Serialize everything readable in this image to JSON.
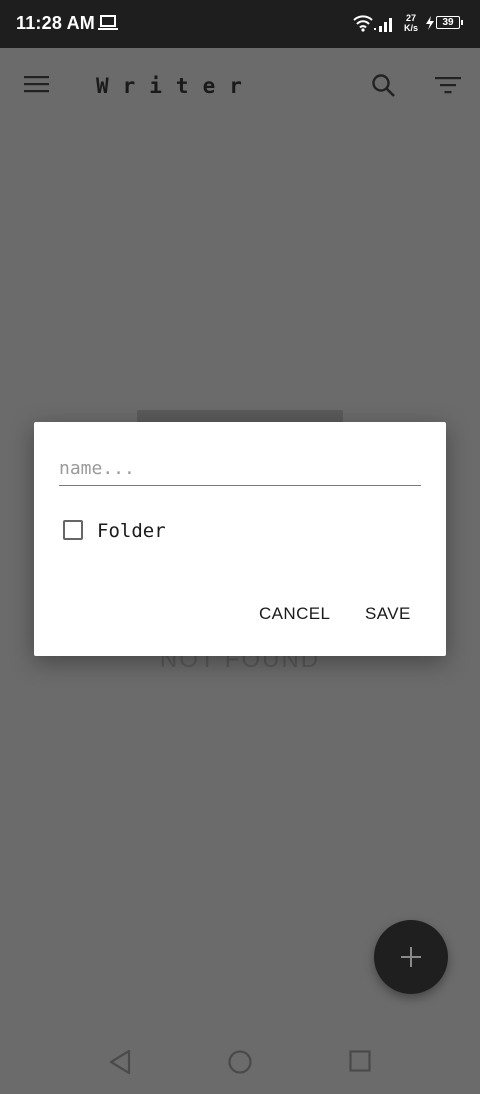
{
  "status_bar": {
    "time": "11:28 AM",
    "net_speed_value": "27",
    "net_speed_unit": "K/s",
    "battery": "39"
  },
  "app_bar": {
    "title": "Writer"
  },
  "empty_state": {
    "text": "NOT FOUND"
  },
  "dialog": {
    "name_placeholder": "name...",
    "name_value": "",
    "folder_label": "Folder",
    "folder_checked": false,
    "cancel_label": "CANCEL",
    "save_label": "SAVE"
  },
  "icons": {
    "menu": "menu-icon",
    "search": "search-icon",
    "filter": "filter-icon",
    "fab": "plus-icon",
    "nav_back": "back-triangle-icon",
    "nav_home": "home-circle-icon",
    "nav_recents": "recents-square-icon"
  },
  "colors": {
    "scrim_background": "#6b6b6b",
    "status_bar": "#1e1e1e",
    "dialog": "#ffffff",
    "fab": "#1f1f1f"
  }
}
